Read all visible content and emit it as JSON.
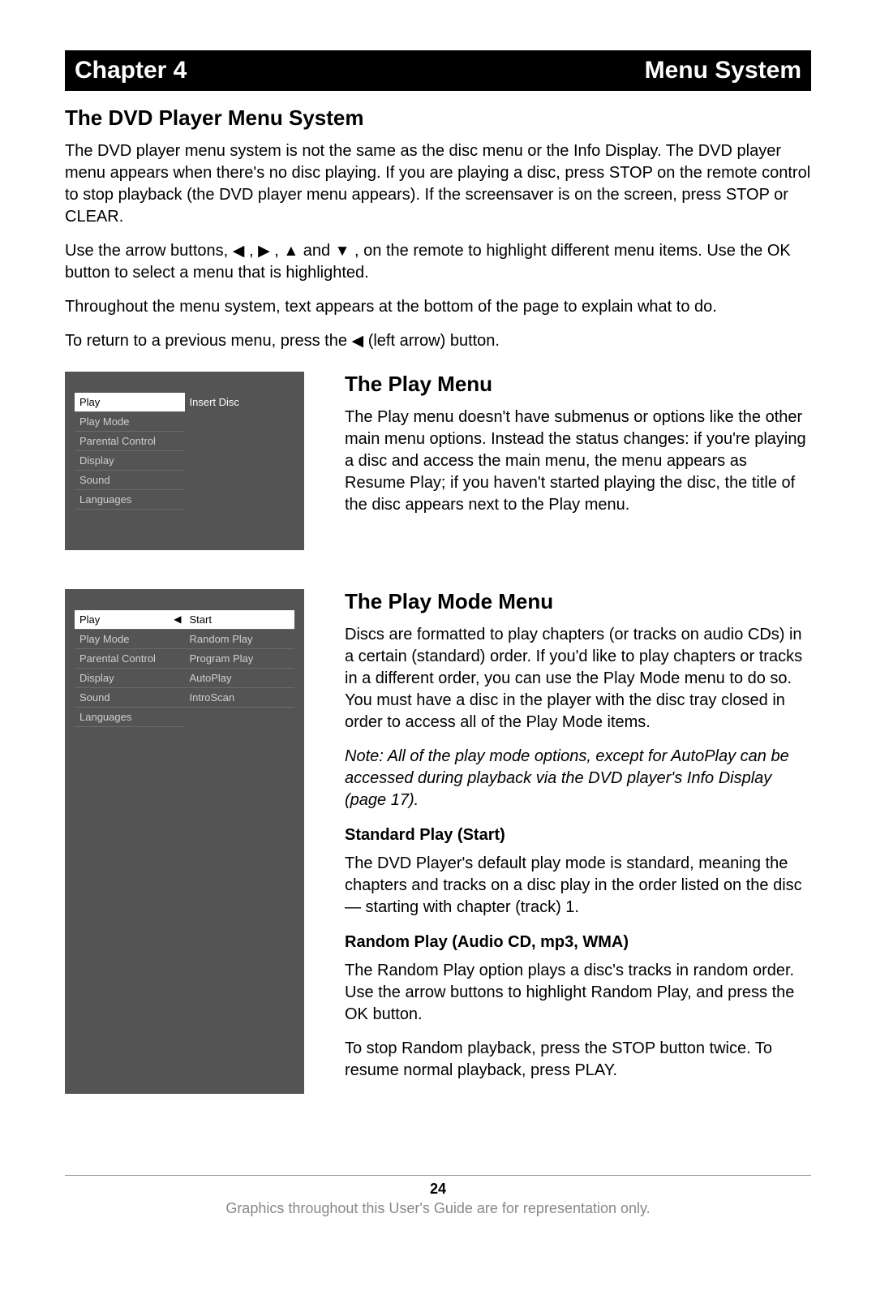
{
  "header": {
    "chapter": "Chapter 4",
    "title": "Menu System"
  },
  "section1": {
    "heading": "The DVD Player Menu System",
    "p1": "The DVD player menu system is not the same as the disc menu or the Info Display. The DVD player menu appears when there's no disc playing. If you are playing a disc, press STOP on the remote control to stop playback (the DVD player menu appears). If the screensaver is on the screen, press STOP or CLEAR.",
    "p2a": "Use the arrow buttons, ",
    "p2b": " , on the remote to highlight different menu items. Use the OK button to select a menu that is highlighted.",
    "p3": "Throughout the menu system, text appears at the bottom of the page to explain what to do.",
    "p4a": "To return to a previous menu, press the ",
    "p4b": " (left arrow) button."
  },
  "arrows": {
    "left": "◀",
    "right": "▶",
    "up": "▲",
    "down": "▼",
    "comma": " , ",
    "and": "  and  "
  },
  "menu1": {
    "left": [
      "Play",
      "Play Mode",
      "Parental Control",
      "Display",
      "Sound",
      "Languages"
    ],
    "right_sel": "Insert Disc"
  },
  "section2": {
    "heading": "The Play Menu",
    "p": "The Play menu doesn't have submenus or options like the other main menu options. Instead the status changes: if you're playing a disc and access the main menu, the menu appears as Resume Play; if you haven't started playing the disc, the title of the disc appears next to the Play menu."
  },
  "menu2": {
    "left": [
      "Play",
      "Play Mode",
      "Parental Control",
      "Display",
      "Sound",
      "Languages"
    ],
    "right": [
      "Start",
      "Random Play",
      "Program Play",
      "AutoPlay",
      "IntroScan"
    ]
  },
  "section3": {
    "heading": "The Play Mode Menu",
    "p": "Discs are formatted to play chapters (or tracks on audio CDs) in a certain (standard) order. If you'd like to play chapters or tracks in a different order, you can use the Play Mode menu to do so. You must have a disc in the player with the disc tray closed in order to access all of the Play Mode items.",
    "note": "Note: All of the play mode options, except for AutoPlay can be accessed during playback via the DVD player's Info Display (page 17).",
    "sub1h": "Standard Play (Start)",
    "sub1p": "The DVD Player's default play mode is standard, meaning the chapters and tracks on a disc play in the order listed on the disc — starting with chapter (track) 1.",
    "sub2h": "Random Play (Audio CD, mp3, WMA)",
    "sub2p1": "The Random Play option plays a disc's tracks in random order. Use the arrow buttons to highlight Random Play, and press the OK button.",
    "sub2p2": "To stop Random playback, press the STOP button twice. To resume normal playback, press PLAY."
  },
  "footer": {
    "page": "24",
    "text": "Graphics throughout this User's Guide are for representation only."
  }
}
